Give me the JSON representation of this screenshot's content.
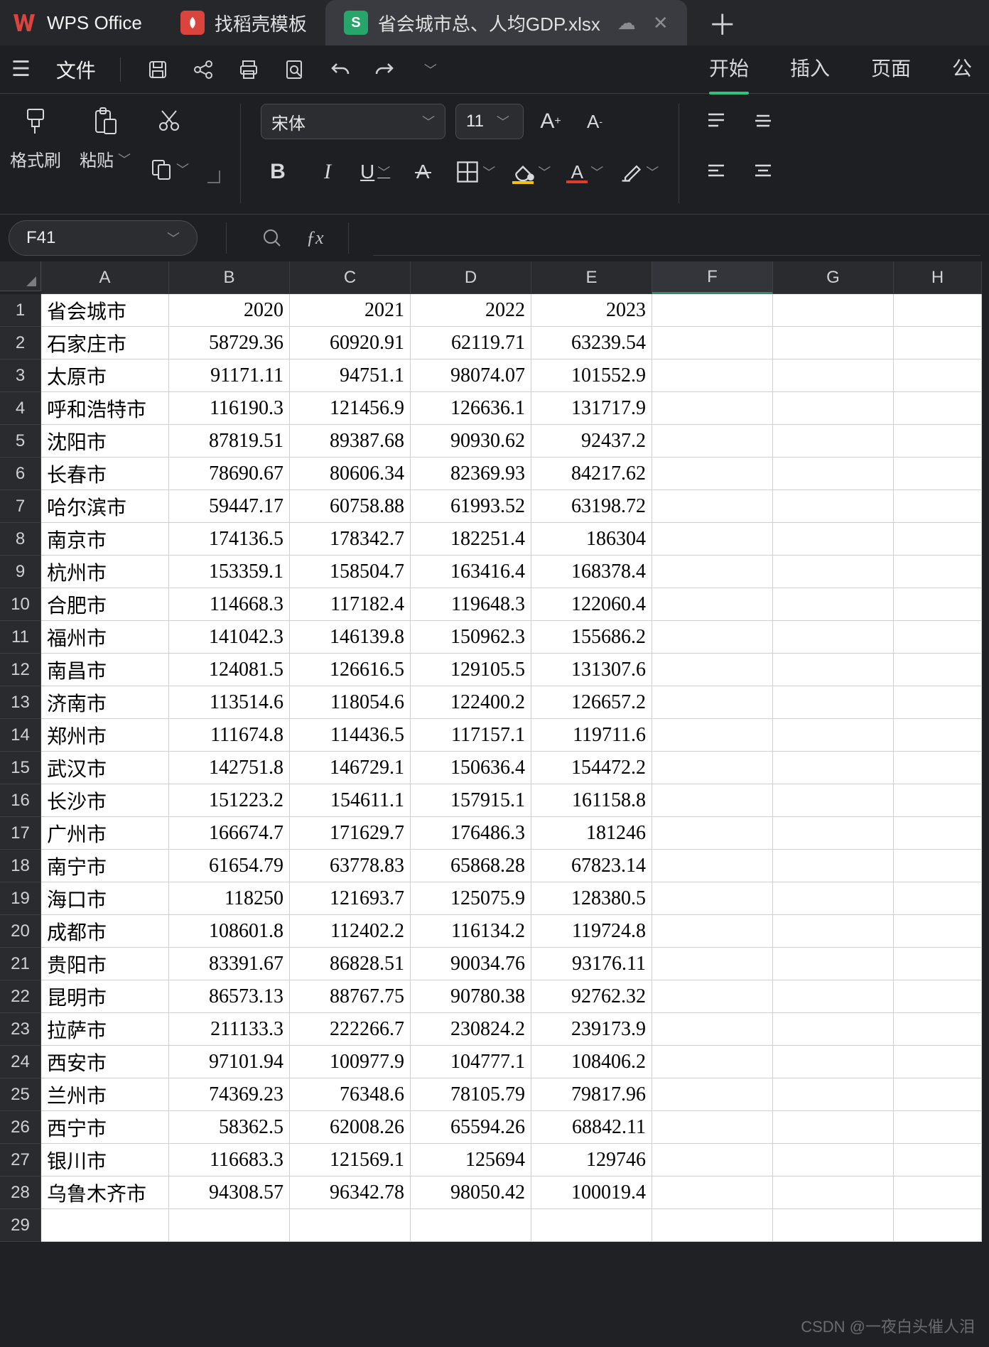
{
  "app_name": "WPS Office",
  "tabs": {
    "docker": "找稻壳模板",
    "sheet_file": "省会城市总、人均GDP.xlsx"
  },
  "menu": {
    "file": "文件",
    "ribbon_tabs": [
      "开始",
      "插入",
      "页面",
      "公"
    ]
  },
  "ribbon": {
    "format_painter": "格式刷",
    "paste": "粘贴",
    "font_name": "宋体",
    "font_size": "11"
  },
  "name_box": "F41",
  "columns": [
    "A",
    "B",
    "C",
    "D",
    "E",
    "F",
    "G",
    "H"
  ],
  "rows": [
    {
      "n": 1,
      "A": "省会城市",
      "B": "2020",
      "C": "2021",
      "D": "2022",
      "E": "2023"
    },
    {
      "n": 2,
      "A": "石家庄市",
      "B": "58729.36",
      "C": "60920.91",
      "D": "62119.71",
      "E": "63239.54"
    },
    {
      "n": 3,
      "A": "太原市",
      "B": "91171.11",
      "C": "94751.1",
      "D": "98074.07",
      "E": "101552.9"
    },
    {
      "n": 4,
      "A": "呼和浩特市",
      "B": "116190.3",
      "C": "121456.9",
      "D": "126636.1",
      "E": "131717.9"
    },
    {
      "n": 5,
      "A": "沈阳市",
      "B": "87819.51",
      "C": "89387.68",
      "D": "90930.62",
      "E": "92437.2"
    },
    {
      "n": 6,
      "A": "长春市",
      "B": "78690.67",
      "C": "80606.34",
      "D": "82369.93",
      "E": "84217.62"
    },
    {
      "n": 7,
      "A": "哈尔滨市",
      "B": "59447.17",
      "C": "60758.88",
      "D": "61993.52",
      "E": "63198.72"
    },
    {
      "n": 8,
      "A": "南京市",
      "B": "174136.5",
      "C": "178342.7",
      "D": "182251.4",
      "E": "186304"
    },
    {
      "n": 9,
      "A": "杭州市",
      "B": "153359.1",
      "C": "158504.7",
      "D": "163416.4",
      "E": "168378.4"
    },
    {
      "n": 10,
      "A": "合肥市",
      "B": "114668.3",
      "C": "117182.4",
      "D": "119648.3",
      "E": "122060.4"
    },
    {
      "n": 11,
      "A": "福州市",
      "B": "141042.3",
      "C": "146139.8",
      "D": "150962.3",
      "E": "155686.2"
    },
    {
      "n": 12,
      "A": "南昌市",
      "B": "124081.5",
      "C": "126616.5",
      "D": "129105.5",
      "E": "131307.6"
    },
    {
      "n": 13,
      "A": "济南市",
      "B": "113514.6",
      "C": "118054.6",
      "D": "122400.2",
      "E": "126657.2"
    },
    {
      "n": 14,
      "A": "郑州市",
      "B": "111674.8",
      "C": "114436.5",
      "D": "117157.1",
      "E": "119711.6"
    },
    {
      "n": 15,
      "A": "武汉市",
      "B": "142751.8",
      "C": "146729.1",
      "D": "150636.4",
      "E": "154472.2"
    },
    {
      "n": 16,
      "A": "长沙市",
      "B": "151223.2",
      "C": "154611.1",
      "D": "157915.1",
      "E": "161158.8"
    },
    {
      "n": 17,
      "A": "广州市",
      "B": "166674.7",
      "C": "171629.7",
      "D": "176486.3",
      "E": "181246"
    },
    {
      "n": 18,
      "A": "南宁市",
      "B": "61654.79",
      "C": "63778.83",
      "D": "65868.28",
      "E": "67823.14"
    },
    {
      "n": 19,
      "A": "海口市",
      "B": "118250",
      "C": "121693.7",
      "D": "125075.9",
      "E": "128380.5"
    },
    {
      "n": 20,
      "A": "成都市",
      "B": "108601.8",
      "C": "112402.2",
      "D": "116134.2",
      "E": "119724.8"
    },
    {
      "n": 21,
      "A": "贵阳市",
      "B": "83391.67",
      "C": "86828.51",
      "D": "90034.76",
      "E": "93176.11"
    },
    {
      "n": 22,
      "A": "昆明市",
      "B": "86573.13",
      "C": "88767.75",
      "D": "90780.38",
      "E": "92762.32"
    },
    {
      "n": 23,
      "A": "拉萨市",
      "B": "211133.3",
      "C": "222266.7",
      "D": "230824.2",
      "E": "239173.9"
    },
    {
      "n": 24,
      "A": "西安市",
      "B": "97101.94",
      "C": "100977.9",
      "D": "104777.1",
      "E": "108406.2"
    },
    {
      "n": 25,
      "A": "兰州市",
      "B": "74369.23",
      "C": "76348.6",
      "D": "78105.79",
      "E": "79817.96"
    },
    {
      "n": 26,
      "A": "西宁市",
      "B": "58362.5",
      "C": "62008.26",
      "D": "65594.26",
      "E": "68842.11"
    },
    {
      "n": 27,
      "A": "银川市",
      "B": "116683.3",
      "C": "121569.1",
      "D": "125694",
      "E": "129746"
    },
    {
      "n": 28,
      "A": "乌鲁木齐市",
      "B": "94308.57",
      "C": "96342.78",
      "D": "98050.42",
      "E": "100019.4"
    },
    {
      "n": 29,
      "A": "",
      "B": "",
      "C": "",
      "D": "",
      "E": ""
    }
  ],
  "selected_col": 5,
  "watermark_csdn": "CSDN @一夜白头催人泪"
}
